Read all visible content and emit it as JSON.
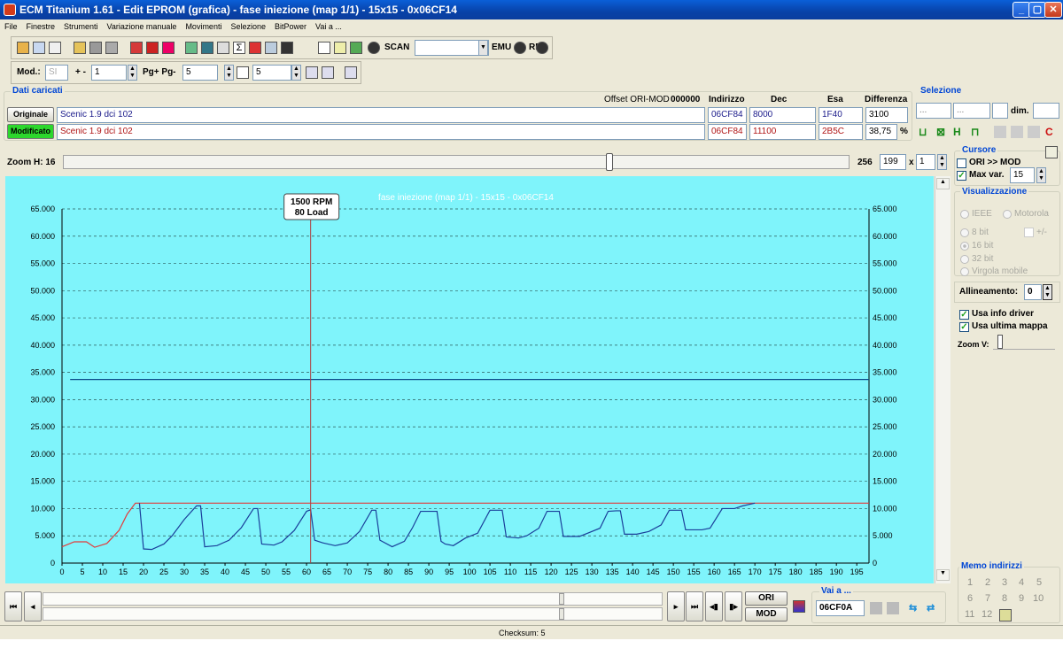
{
  "window": {
    "title": "ECM Titanium 1.61 - Edit EPROM (grafica) - fase iniezione (map 1/1) - 15x15 - 0x06CF14",
    "min": "_",
    "max": "▢",
    "close": "✕"
  },
  "menu": [
    "File",
    "Finestre",
    "Strumenti",
    "Variazione manuale",
    "Movimenti",
    "Selezione",
    "BitPower",
    "Vai a ..."
  ],
  "toolbar": {
    "scan": "SCAN",
    "scan_select": "",
    "emu": "EMU",
    "rec": "REC"
  },
  "toolbar2": {
    "mod_label": "Mod.:",
    "mod_value": "SI",
    "plusminus_label": "+ -",
    "plusminus_value": "1",
    "pg_label": "Pg+ Pg-",
    "pg_value": "5",
    "p_value": "5"
  },
  "dati": {
    "group_label": "Dati caricati",
    "offset_label": "Offset ORI-MOD",
    "offset_value": "000000",
    "headers": {
      "indirizzo": "Indirizzo",
      "dec": "Dec",
      "esa": "Esa",
      "differenza": "Differenza"
    },
    "originale": {
      "label": "Originale",
      "name": "Scenic 1.9 dci 102",
      "indirizzo": "06CF84",
      "dec": "8000",
      "esa": "1F40",
      "diff": "3100"
    },
    "modificato": {
      "label": "Modificato",
      "name": "Scenic 1.9 dci 102",
      "indirizzo": "06CF84",
      "dec": "11100",
      "esa": "2B5C",
      "diff": "38,75",
      "unit": "%"
    }
  },
  "selezione": {
    "label": "Selezione",
    "a": "...",
    "b": "...",
    "c": "",
    "dim_label": "dim.",
    "dim_value": ""
  },
  "zoom": {
    "label": "Zoom H: 16",
    "max": "256",
    "value": "199",
    "mult": "x",
    "factor": "1",
    "level": 0.695
  },
  "cursor_box": {
    "label": "Cursore",
    "ori_mod": "ORI >> MOD",
    "max_var_label": "Max var.",
    "max_var": "15"
  },
  "visualizzazione": {
    "label": "Visualizzazione",
    "ieee": "IEEE",
    "motorola": "Motorola",
    "b8": "8 bit",
    "pm": "+/-",
    "b16": "16 bit",
    "b32": "32 bit",
    "virgola": "Virgola mobile",
    "alline_label": "Allineamento:",
    "alline_value": "0",
    "usa_driver": "Usa info driver",
    "usa_mappa": "Usa ultima mappa",
    "zoomv": "Zoom V:"
  },
  "memo": {
    "label": "Memo indirizzi",
    "items": [
      "1",
      "2",
      "3",
      "4",
      "5",
      "6",
      "7",
      "8",
      "9",
      "10",
      "11",
      "12"
    ]
  },
  "vai": {
    "label": "Vai a ...",
    "value": "06CF0A"
  },
  "buttons": {
    "ori": "ORI",
    "mod": "MOD"
  },
  "status": {
    "checksum": "Checksum: 5"
  },
  "chart_data": {
    "type": "line",
    "title": "fase iniezione (map 1/1) - 15x15 - 0x06CF14",
    "cursor_label": [
      "1500 RPM",
      "80 Load"
    ],
    "cursor_x": 61,
    "xlim": [
      0,
      198
    ],
    "ylim": [
      0,
      65000
    ],
    "x_ticks": [
      0,
      5,
      10,
      15,
      20,
      25,
      30,
      35,
      40,
      45,
      50,
      55,
      60,
      65,
      70,
      75,
      80,
      85,
      90,
      95,
      100,
      105,
      110,
      115,
      120,
      125,
      130,
      135,
      140,
      145,
      150,
      155,
      160,
      165,
      170,
      175,
      180,
      185,
      190,
      195
    ],
    "y_ticks": [
      "65.000",
      "60.000",
      "55.000",
      "50.000",
      "45.000",
      "40.000",
      "35.000",
      "30.000",
      "25.000",
      "20.000",
      "15.000",
      "10.000",
      "5.000",
      "0"
    ],
    "y_tick_values": [
      65000,
      60000,
      55000,
      50000,
      45000,
      40000,
      35000,
      30000,
      25000,
      20000,
      15000,
      10000,
      5000,
      0
    ],
    "grid": true,
    "series": [
      {
        "color": "#0b4a8a",
        "x": [
          2,
          198
        ],
        "y": [
          33700,
          33700
        ]
      },
      {
        "color": "#e23b3b",
        "x": [
          0,
          3,
          6,
          8,
          11,
          14,
          16,
          18,
          19,
          198
        ],
        "y": [
          3000,
          3900,
          3900,
          2900,
          3600,
          6000,
          9000,
          11000,
          11000,
          11000
        ]
      },
      {
        "color": "#1a3f9a",
        "x": [
          19,
          20,
          22,
          25,
          27,
          30,
          33,
          34,
          35,
          38,
          41,
          44,
          47,
          48,
          49,
          52,
          54,
          57,
          60,
          61,
          62,
          64,
          67,
          70,
          73,
          76,
          77,
          78,
          81,
          84,
          86,
          88,
          90,
          92,
          93,
          94,
          96,
          99,
          102,
          105,
          107,
          108,
          109,
          112,
          114,
          117,
          119,
          121,
          122,
          123,
          125,
          127,
          129,
          132,
          134,
          136,
          137,
          138,
          141,
          144,
          147,
          149,
          151,
          152,
          153,
          155,
          157,
          159,
          161,
          162,
          163,
          165,
          167,
          170
        ],
        "y": [
          11000,
          2600,
          2500,
          3500,
          5000,
          8000,
          10500,
          10500,
          3000,
          3200,
          4200,
          6500,
          10000,
          10000,
          3500,
          3300,
          3900,
          6000,
          9500,
          9800,
          4200,
          3700,
          3200,
          3700,
          5800,
          9700,
          9700,
          4200,
          3000,
          4000,
          6500,
          9500,
          9500,
          9500,
          4000,
          3500,
          3200,
          4600,
          5500,
          9700,
          9700,
          9700,
          4800,
          4600,
          5000,
          6400,
          9500,
          9500,
          9500,
          4900,
          4900,
          4900,
          5500,
          6400,
          9500,
          9600,
          9600,
          5300,
          5300,
          5800,
          7000,
          9700,
          9700,
          9700,
          6100,
          6100,
          6100,
          6400,
          8800,
          10000,
          10000,
          10000,
          10500,
          11000
        ]
      }
    ]
  }
}
